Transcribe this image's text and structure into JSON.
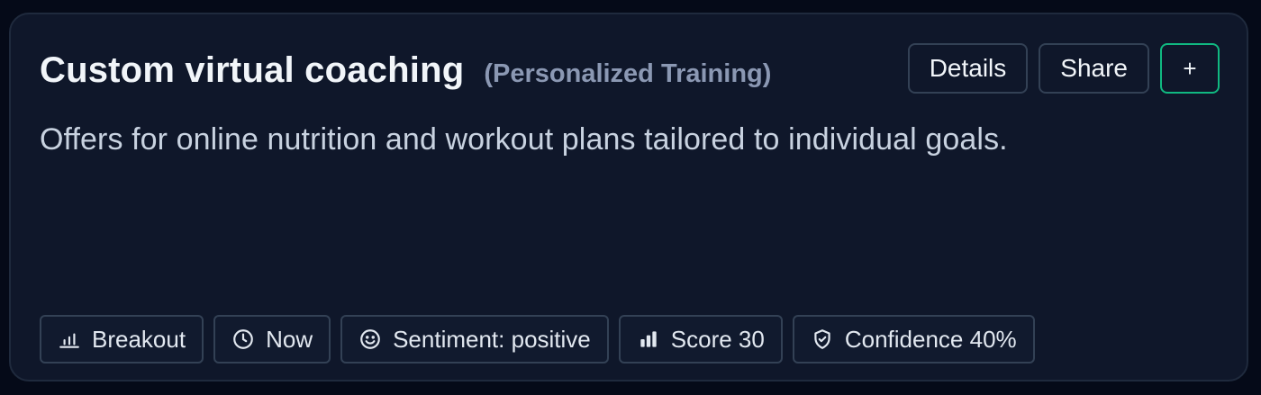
{
  "card": {
    "title": "Custom virtual coaching",
    "category": "(Personalized Training)",
    "description": "Offers for online nutrition and workout plans tailored to individual goals."
  },
  "actions": {
    "details_label": "Details",
    "share_label": "Share",
    "add_label": "+"
  },
  "chips": [
    {
      "icon": "bar-chart-icon",
      "label": "Breakout"
    },
    {
      "icon": "clock-icon",
      "label": "Now"
    },
    {
      "icon": "smiley-icon",
      "label": "Sentiment: positive"
    },
    {
      "icon": "signal-bars-icon",
      "label": "Score 30"
    },
    {
      "icon": "shield-check-icon",
      "label": "Confidence 40%"
    }
  ],
  "colors": {
    "background": "#050a18",
    "card": "#0f172a",
    "border": "#334155",
    "accent": "#10b981",
    "text": "#f1f5f9",
    "muted": "#8b98b3"
  }
}
